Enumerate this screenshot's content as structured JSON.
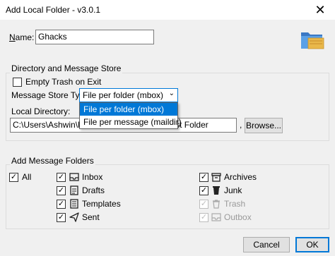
{
  "window": {
    "title": "Add Local Folder - v3.0.1",
    "close_glyph": "✕"
  },
  "name": {
    "label": "Name:",
    "value": "Ghacks"
  },
  "directory_group": {
    "title": "Directory and Message Store",
    "empty_trash_label": "Empty Trash on Exit",
    "empty_trash_checked": false,
    "message_store_label": "Message Store Type:",
    "message_store_selected": "File per folder (mbox)",
    "message_store_options": [
      "File per folder (mbox)",
      "File per message (maildir)"
    ],
    "local_directory_label": "Local Directory:",
    "local_directory_value": "C:\\Users\\Ashwin\\Downloads\\Test Folder\\Test Folder",
    "comma": ",",
    "browse_label": "Browse..."
  },
  "message_folders_group": {
    "title": "Add Message Folders",
    "all_label": "All",
    "folders_left": [
      {
        "label": "Inbox",
        "icon": "inbox-icon",
        "checked": true,
        "enabled": true
      },
      {
        "label": "Drafts",
        "icon": "drafts-icon",
        "checked": true,
        "enabled": true
      },
      {
        "label": "Templates",
        "icon": "templates-icon",
        "checked": true,
        "enabled": true
      },
      {
        "label": "Sent",
        "icon": "sent-icon",
        "checked": true,
        "enabled": true
      }
    ],
    "folders_right": [
      {
        "label": "Archives",
        "icon": "archives-icon",
        "checked": true,
        "enabled": true
      },
      {
        "label": "Junk",
        "icon": "junk-icon",
        "checked": true,
        "enabled": true
      },
      {
        "label": "Trash",
        "icon": "trash-icon",
        "checked": true,
        "enabled": false
      },
      {
        "label": "Outbox",
        "icon": "outbox-icon",
        "checked": true,
        "enabled": false
      }
    ]
  },
  "buttons": {
    "cancel": "Cancel",
    "ok": "OK"
  },
  "colors": {
    "accent": "#0078d7",
    "folder_icon": "#4a90d9"
  }
}
